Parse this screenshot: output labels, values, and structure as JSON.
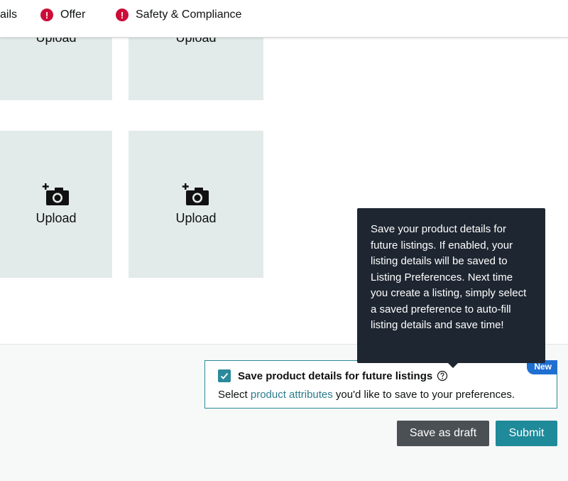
{
  "tabs": [
    {
      "label": "ails",
      "has_error": false
    },
    {
      "label": "Offer",
      "has_error": true
    },
    {
      "label": "Safety & Compliance",
      "has_error": true
    }
  ],
  "upload": {
    "label": "Upload"
  },
  "tooltip": {
    "text": "Save your product details for future listings. If enabled, your listing details will be saved to Listing Preferences. Next time you create a listing, simply select a saved preference to auto-fill listing details and save time!"
  },
  "save_details": {
    "checked": true,
    "title": "Save product details for future listings",
    "badge": "New",
    "sub_prefix": "Select ",
    "sub_link": "product attributes",
    "sub_suffix": " you'd like to save to your preferences."
  },
  "actions": {
    "draft_label": "Save as draft",
    "submit_label": "Submit"
  },
  "colors": {
    "error": "#cc0c39",
    "accent": "#1f8a99",
    "tile": "#e3eaea",
    "tooltip": "#1e2631"
  },
  "icons": [
    "error-icon",
    "camera-add-icon",
    "check-icon",
    "help-icon"
  ]
}
